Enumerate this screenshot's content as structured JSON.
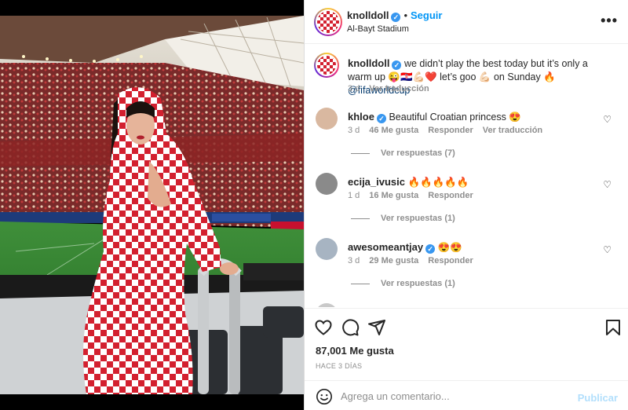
{
  "post": {
    "username": "knolldoll",
    "verified_mark": "✓",
    "follow_label": "Seguir",
    "dot": "•",
    "location": "Al-Bayt Stadium",
    "more_icon": "more-horizontal-icon",
    "caption": {
      "username": "knolldoll",
      "text": "we didn’t play the best today but it’s only a warm up 😜🇭🇷💪🏻❤️ let’s goo 💪🏻 on Sunday 🔥",
      "mention": "@fifaworldcup",
      "time": "3 d",
      "translate_label": "Ver traducción"
    }
  },
  "comments": [
    {
      "username": "khloe",
      "text": "Beautiful Croatian princess 😍",
      "time": "3 d",
      "likes": "46 Me gusta",
      "reply_label": "Responder",
      "translate_label": "Ver traducción",
      "replies_label": "Ver respuestas (7)",
      "avatar_color": "#d9b8a0"
    },
    {
      "username": "ecija_ivusic",
      "text": "🔥🔥🔥🔥🔥",
      "time": "1 d",
      "likes": "16 Me gusta",
      "reply_label": "Responder",
      "replies_label": "Ver respuestas (1)",
      "avatar_color": "#8a8a8a"
    },
    {
      "username": "awesomeantjay",
      "text": "😍😍",
      "time": "3 d",
      "likes": "29 Me gusta",
      "reply_label": "Responder",
      "replies_label": "Ver respuestas (1)",
      "avatar_color": "#a7b4c2"
    }
  ],
  "actions": {
    "like_icon": "heart-icon",
    "comment_icon": "comment-icon",
    "share_icon": "send-icon",
    "save_icon": "bookmark-icon",
    "likes": "87,001 Me gusta",
    "time_ago": "HACE 3 DÍAS"
  },
  "composer": {
    "emoji_icon": "emoji-icon",
    "placeholder": "Agrega un comentario...",
    "publish_label": "Publicar"
  },
  "colors": {
    "accent": "#0095f6",
    "verified": "#3897f0",
    "checker_red": "#d3202f"
  }
}
